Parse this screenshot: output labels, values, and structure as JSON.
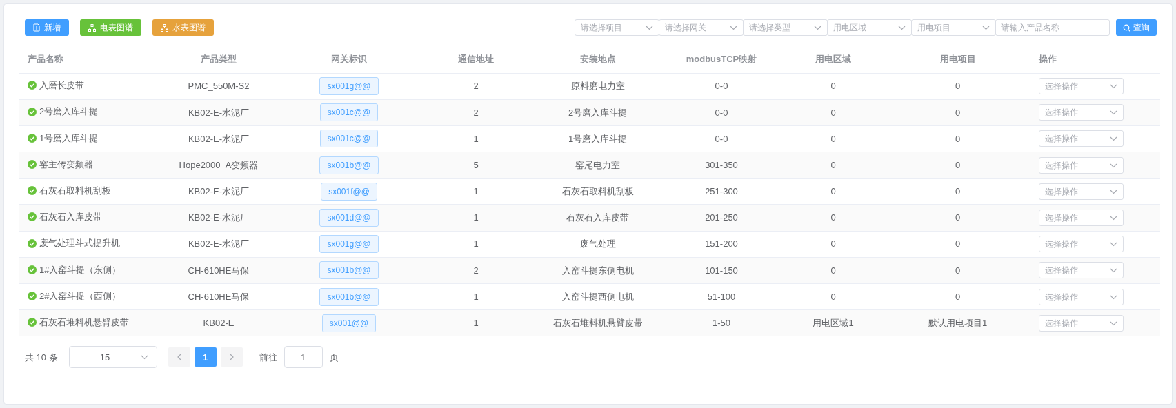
{
  "toolbar": {
    "buttons": [
      {
        "label": "新增",
        "kind": "add"
      },
      {
        "label": "电表图谱",
        "kind": "electric"
      },
      {
        "label": "水表图谱",
        "kind": "water"
      }
    ]
  },
  "filters": [
    {
      "placeholder": "请选择项目",
      "kind": "select"
    },
    {
      "placeholder": "请选择网关",
      "kind": "select"
    },
    {
      "placeholder": "请选择类型",
      "kind": "select"
    },
    {
      "placeholder": "用电区域",
      "kind": "select"
    },
    {
      "placeholder": "用电项目",
      "kind": "select"
    },
    {
      "placeholder": "请输入产品名称",
      "kind": "input"
    }
  ],
  "search_button": {
    "label": "查询"
  },
  "table": {
    "columns": [
      "产品名称",
      "产品类型",
      "网关标识",
      "通信地址",
      "安装地点",
      "modbusTCP映射",
      "用电区域",
      "用电项目",
      "操作"
    ],
    "rows": [
      {
        "online": true,
        "name": "入磨长皮带",
        "type": "PMC_550M-S2",
        "gateway": "sx001g@@",
        "address": "2",
        "location": "原料磨电力室",
        "modbus": "0-0",
        "area": "0",
        "project": "0",
        "action": "选择操作"
      },
      {
        "online": true,
        "name": "2号磨入库斗提",
        "type": "KB02-E-水泥厂",
        "gateway": "sx001c@@",
        "address": "2",
        "location": "2号磨入库斗提",
        "modbus": "0-0",
        "area": "0",
        "project": "0",
        "action": "选择操作"
      },
      {
        "online": true,
        "name": "1号磨入库斗提",
        "type": "KB02-E-水泥厂",
        "gateway": "sx001c@@",
        "address": "1",
        "location": "1号磨入库斗提",
        "modbus": "0-0",
        "area": "0",
        "project": "0",
        "action": "选择操作"
      },
      {
        "online": true,
        "name": "窑主传变频器",
        "type": "Hope2000_A变频器",
        "gateway": "sx001b@@",
        "address": "5",
        "location": "窑尾电力室",
        "modbus": "301-350",
        "area": "0",
        "project": "0",
        "action": "选择操作"
      },
      {
        "online": true,
        "name": "石灰石取料机刮板",
        "type": "KB02-E-水泥厂",
        "gateway": "sx001f@@",
        "address": "1",
        "location": "石灰石取料机刮板",
        "modbus": "251-300",
        "area": "0",
        "project": "0",
        "action": "选择操作"
      },
      {
        "online": true,
        "name": "石灰石入库皮带",
        "type": "KB02-E-水泥厂",
        "gateway": "sx001d@@",
        "address": "1",
        "location": "石灰石入库皮带",
        "modbus": "201-250",
        "area": "0",
        "project": "0",
        "action": "选择操作"
      },
      {
        "online": true,
        "name": "废气处理斗式提升机",
        "type": "KB02-E-水泥厂",
        "gateway": "sx001g@@",
        "address": "1",
        "location": "废气处理",
        "modbus": "151-200",
        "area": "0",
        "project": "0",
        "action": "选择操作"
      },
      {
        "online": true,
        "name": "1#入窑斗提（东侧）",
        "type": "CH-610HE马保",
        "gateway": "sx001b@@",
        "address": "2",
        "location": "入窑斗提东侧电机",
        "modbus": "101-150",
        "area": "0",
        "project": "0",
        "action": "选择操作"
      },
      {
        "online": true,
        "name": "2#入窑斗提（西侧）",
        "type": "CH-610HE马保",
        "gateway": "sx001b@@",
        "address": "1",
        "location": "入窑斗提西侧电机",
        "modbus": "51-100",
        "area": "0",
        "project": "0",
        "action": "选择操作"
      },
      {
        "online": true,
        "name": "石灰石堆料机悬臂皮带",
        "type": "KB02-E",
        "gateway": "sx001@@",
        "address": "1",
        "location": "石灰石堆料机悬臂皮带",
        "modbus": "1-50",
        "area": "用电区域1",
        "project": "默认用电项目1",
        "action": "选择操作"
      }
    ]
  },
  "pagination": {
    "total": "共 10 条",
    "page_size": "15",
    "pages": [
      {
        "label": "1",
        "selected": true
      }
    ],
    "goto_label": "前往",
    "goto_value": "1",
    "page_suffix": "页"
  }
}
